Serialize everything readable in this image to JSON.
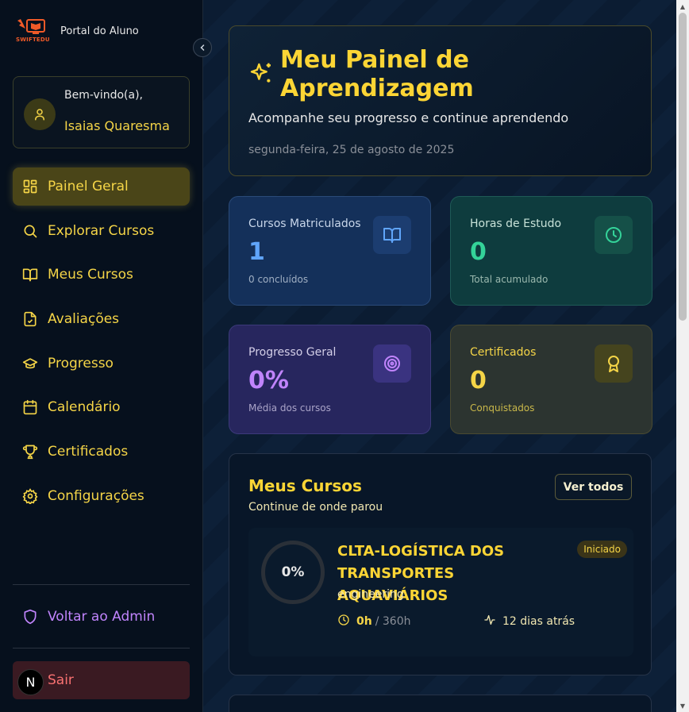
{
  "brand": {
    "logo_text": "SWIFTEDU",
    "title": "Portal do Aluno"
  },
  "welcome": {
    "label": "Bem-vindo(a),",
    "name": "Isaias Quaresma"
  },
  "nav": [
    {
      "label": "Painel Geral",
      "icon": "layout-dashboard-icon",
      "active": true
    },
    {
      "label": "Explorar Cursos",
      "icon": "search-icon"
    },
    {
      "label": "Meus Cursos",
      "icon": "book-open-icon"
    },
    {
      "label": "Avaliações",
      "icon": "file-check-icon"
    },
    {
      "label": "Progresso",
      "icon": "graduation-cap-icon"
    },
    {
      "label": "Calendário",
      "icon": "calendar-icon"
    },
    {
      "label": "Certificados",
      "icon": "trophy-icon"
    },
    {
      "label": "Configurações",
      "icon": "settings-icon"
    }
  ],
  "admin_link": "Voltar ao Admin",
  "logout": "Sair",
  "n_badge": "N",
  "hero": {
    "title": "Meu Painel de Aprendizagem",
    "subtitle": "Acompanhe seu progresso e continue aprendendo",
    "date": "segunda-feira, 25 de agosto de 2025"
  },
  "stats": {
    "enrolled": {
      "label": "Cursos Matriculados",
      "value": "1",
      "sub": "0 concluídos"
    },
    "hours": {
      "label": "Horas de Estudo",
      "value": "0",
      "sub": "Total acumulado"
    },
    "progress": {
      "label": "Progresso Geral",
      "value": "0%",
      "sub": "Média dos cursos"
    },
    "certificates": {
      "label": "Certificados",
      "value": "0",
      "sub": "Conquistados"
    }
  },
  "courses": {
    "title": "Meus Cursos",
    "subtitle": "Continue de onde parou",
    "view_all": "Ver todos",
    "items": [
      {
        "progress": "0%",
        "name": "CLTA-LOGÍSTICA DOS TRANSPORTES AQUAVIÁRIOS",
        "category": "engineering",
        "status": "Iniciado",
        "hours_done": "0h",
        "hours_total": "/ 360h",
        "last_access": "12 dias atrás"
      }
    ]
  },
  "colors": {
    "accent": "#fcd535",
    "sidebar_bg": "#06101d",
    "main_bg": "#0b1c32"
  }
}
